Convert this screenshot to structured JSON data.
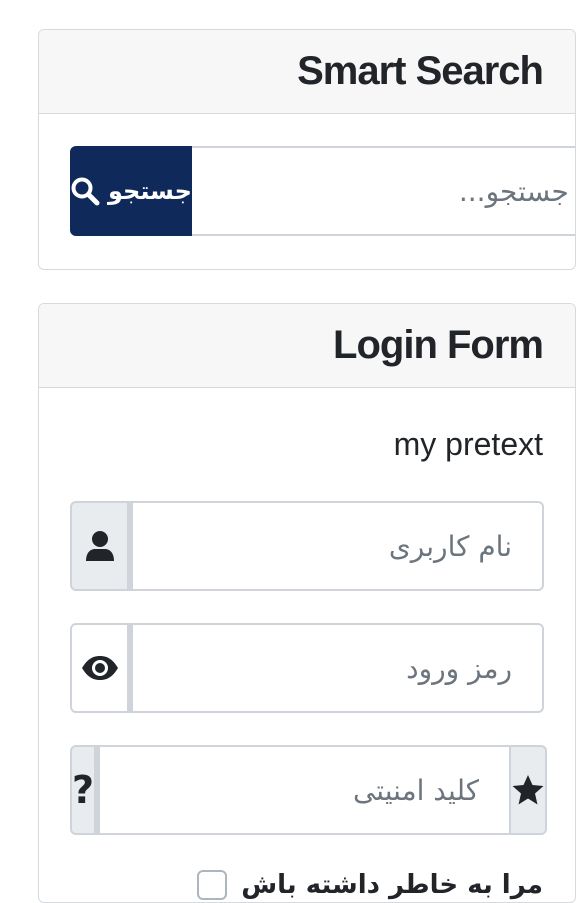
{
  "search_card": {
    "title": "Smart Search",
    "button_label": "جستجو",
    "button_icon": "search-icon",
    "input_placeholder": "جستجو...",
    "input_value": "",
    "accent_color": "#0f2a5a"
  },
  "login_card": {
    "title": "Login Form",
    "pretext": "my pretext",
    "username": {
      "placeholder": "نام کاربری",
      "value": "",
      "icon": "user-icon"
    },
    "password": {
      "placeholder": "رمز ورود",
      "value": "",
      "icon": "eye-icon"
    },
    "security_key": {
      "placeholder": "کلید امنیتی",
      "value": "",
      "icon_left": "?",
      "icon_right": "star-icon"
    },
    "remember_label": "مرا به خاطر داشته باش",
    "remember_checked": false
  }
}
